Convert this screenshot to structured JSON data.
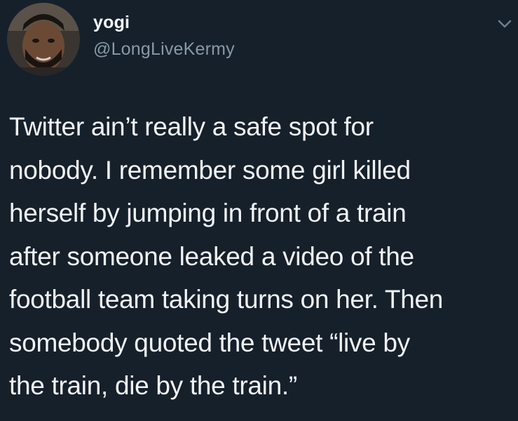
{
  "author": {
    "name": "yogi",
    "handle": "@LongLiveKermy",
    "avatar_icon": "profile-photo"
  },
  "menu": {
    "icon": "chevron-down-icon"
  },
  "tweet": {
    "lines": [
      "Twitter ain’t really a safe spot for",
      "nobody. I remember some girl killed",
      "herself by jumping in front of a train",
      "after someone leaked a video of the",
      "football team taking turns on her. Then",
      "somebody quoted the tweet “live by",
      "the train, die by the train.”"
    ]
  },
  "colors": {
    "background": "#16202b",
    "text": "#f1f3f5",
    "handle": "#8899a6"
  }
}
